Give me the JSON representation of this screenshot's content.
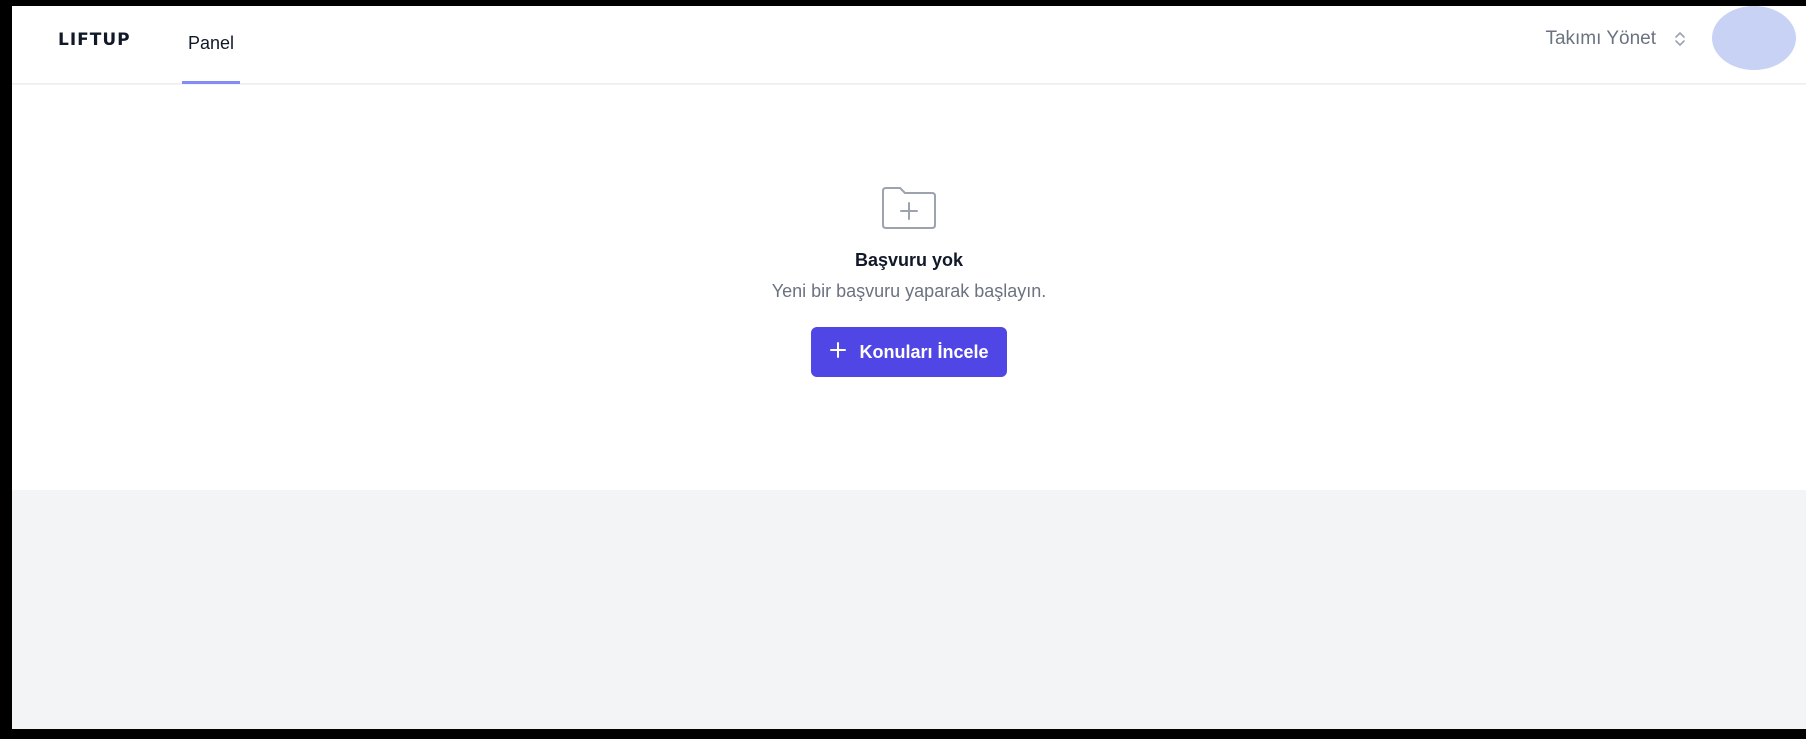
{
  "header": {
    "logo_text": "LIFTUP",
    "tabs": [
      {
        "label": "Panel",
        "active": true
      }
    ],
    "team_selector": {
      "label": "Takımı Yönet",
      "icon": "chevrons-up-down-icon"
    },
    "avatar": {
      "color": "#c7d2f5"
    }
  },
  "empty_state": {
    "icon": "folder-plus-icon",
    "title": "Başvuru yok",
    "subtitle": "Yeni bir başvuru yaparak başlayın.",
    "button": {
      "label": "Konuları İncele",
      "icon": "plus-icon"
    }
  },
  "colors": {
    "accent": "#4f46e5",
    "tab_indicator": "#818cf8",
    "page_bg": "#f3f4f6"
  }
}
